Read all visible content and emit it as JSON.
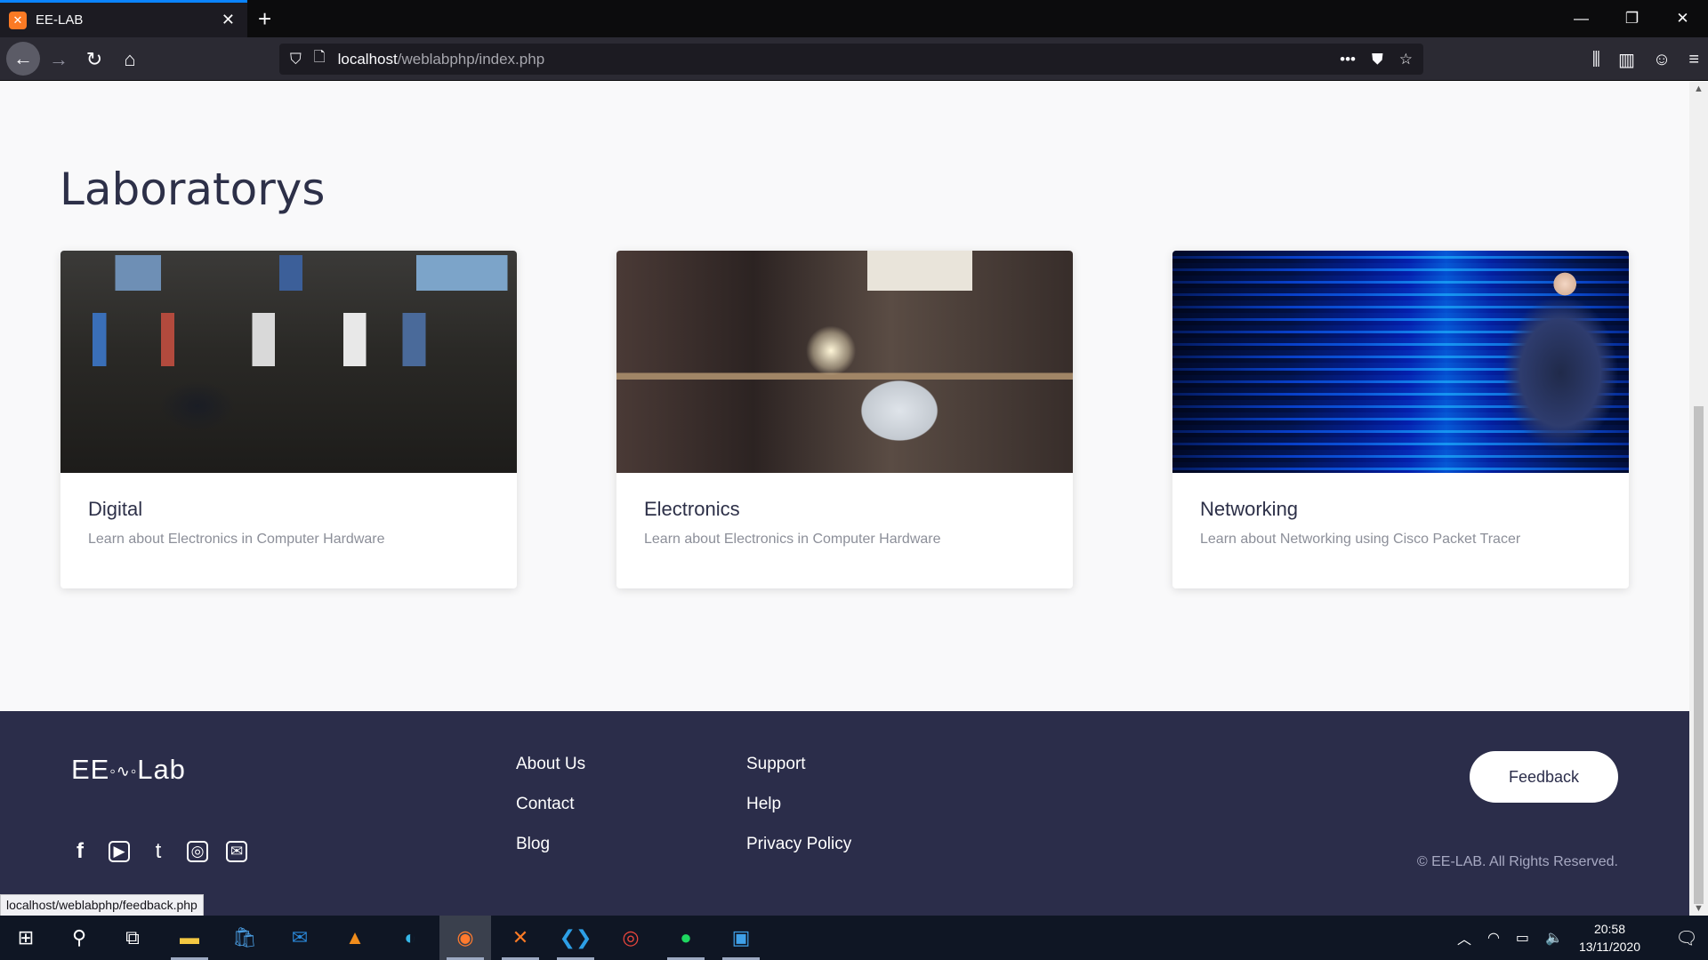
{
  "browser": {
    "tab_title": "EE-LAB",
    "url_host": "localhost",
    "url_path": "/weblabphp/index.php",
    "status_url": "localhost/weblabphp/feedback.php"
  },
  "page": {
    "heading": "Laboratorys",
    "cards": [
      {
        "title": "Digital",
        "description": "Learn about Electronics in Computer Hardware",
        "image": "control-room-photo"
      },
      {
        "title": "Electronics",
        "description": "Learn about Electronics in Computer Hardware",
        "image": "electronics-workbench-photo"
      },
      {
        "title": "Networking",
        "description": "Learn about Networking using Cisco Packet Tracer",
        "image": "server-rack-photo"
      }
    ]
  },
  "footer": {
    "logo_left": "EE",
    "logo_right": "Lab",
    "socials": [
      "facebook-icon",
      "youtube-icon",
      "tumblr-icon",
      "instagram-icon",
      "mail-icon"
    ],
    "links_col1": [
      "About Us",
      "Contact",
      "Blog"
    ],
    "links_col2": [
      "Support",
      "Help",
      "Privacy Policy"
    ],
    "feedback_label": "Feedback",
    "copyright": "© EE-LAB. All Rights Reserved."
  },
  "taskbar": {
    "time": "20:58",
    "date": "13/11/2020"
  }
}
